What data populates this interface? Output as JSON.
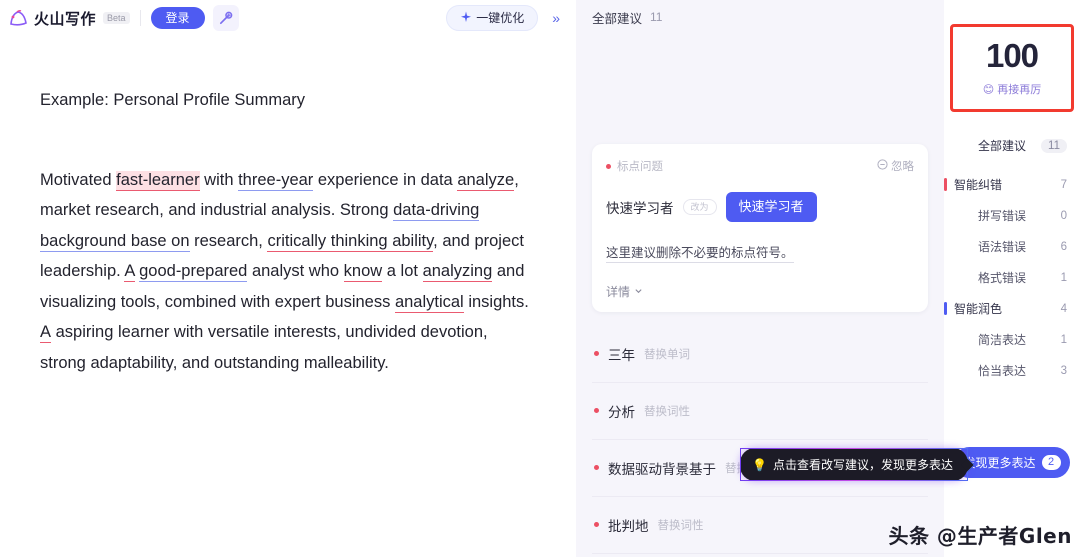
{
  "topbar": {
    "brand_name": "火山写作",
    "beta_badge": "Beta",
    "login_label": "登录",
    "magic_icon": "magic-wand-icon",
    "optimize_label": "一键优化",
    "sparkle_icon": "sparkle-icon",
    "collapse_label": "»"
  },
  "document": {
    "title": "Example: Personal Profile Summary",
    "paragraph": {
      "t1": "Motivated ",
      "m_fast_learner": "fast-learner",
      "t2": " with ",
      "m_three_year": "three-year",
      "t3": " experience in data ",
      "m_analyze": "analyze",
      "t4": ", market research, and industrial analysis. Strong ",
      "m_data_driving": "data-driving background base on",
      "t5": " research, ",
      "m_critically": "critically thinking ability",
      "t6": ", and project leadership. ",
      "m_a1": "A",
      "t7": " ",
      "m_good_prepared": "good-prepared",
      "t8": " analyst who ",
      "m_know": "know",
      "t9": " a lot ",
      "m_analyzing": "analyzing",
      "t10": " and visualizing tools, combined with expert business ",
      "m_analytical": "analytical",
      "t11": " insights. ",
      "m_a2": "A",
      "t12": " aspiring learner with versatile interests, undivided devotion, strong adaptability, and outstanding malleability."
    }
  },
  "suggestions": {
    "header_label": "全部建议",
    "header_count": "11",
    "card": {
      "tag": "标点问题",
      "ignore_label": "忽略",
      "ignore_icon": "circle-minus-icon",
      "original": "快速学习者",
      "arrow_pill": "改为",
      "replacement": "快速学习者",
      "explanation": "这里建议删除不必要的标点符号。",
      "detail_label": "详情",
      "detail_icon": "chevron-down-icon"
    },
    "items": [
      {
        "word": "三年",
        "kind": "替换单词",
        "dot": "red"
      },
      {
        "word": "分析",
        "kind": "替换词性",
        "dot": "red"
      },
      {
        "word": "数据驱动背景基于",
        "kind": "替换词组",
        "dot": "red"
      },
      {
        "word": "批判地",
        "kind": "替换词性",
        "dot": "red"
      }
    ]
  },
  "sidebar": {
    "score": "100",
    "score_label": "再接再厉",
    "score_emoji": "😊",
    "categories": [
      {
        "name": "全部建议",
        "count": "11",
        "level": "top",
        "bar": "none"
      },
      {
        "name": "智能纠错",
        "count": "7",
        "level": "main",
        "bar": "red"
      },
      {
        "name": "拼写错误",
        "count": "0",
        "level": "sub",
        "bar": "none"
      },
      {
        "name": "语法错误",
        "count": "6",
        "level": "sub",
        "bar": "none"
      },
      {
        "name": "格式错误",
        "count": "1",
        "level": "sub",
        "bar": "none"
      },
      {
        "name": "智能润色",
        "count": "4",
        "level": "main",
        "bar": "blue"
      },
      {
        "name": "简洁表达",
        "count": "1",
        "level": "sub",
        "bar": "none"
      },
      {
        "name": "恰当表达",
        "count": "3",
        "level": "sub",
        "bar": "none"
      }
    ],
    "discover_label": "发现更多表达",
    "discover_count": "2"
  },
  "tooltip": {
    "icon": "lightbulb-icon",
    "text": "点击查看改写建议，发现更多表达"
  },
  "watermark": {
    "text": "头条 @生产者Glen"
  },
  "colors": {
    "accent_blue": "#4e5bf2",
    "error_red": "#ec4f63",
    "panel_bg": "#f6f5fb",
    "score_border": "#f23a2f"
  }
}
